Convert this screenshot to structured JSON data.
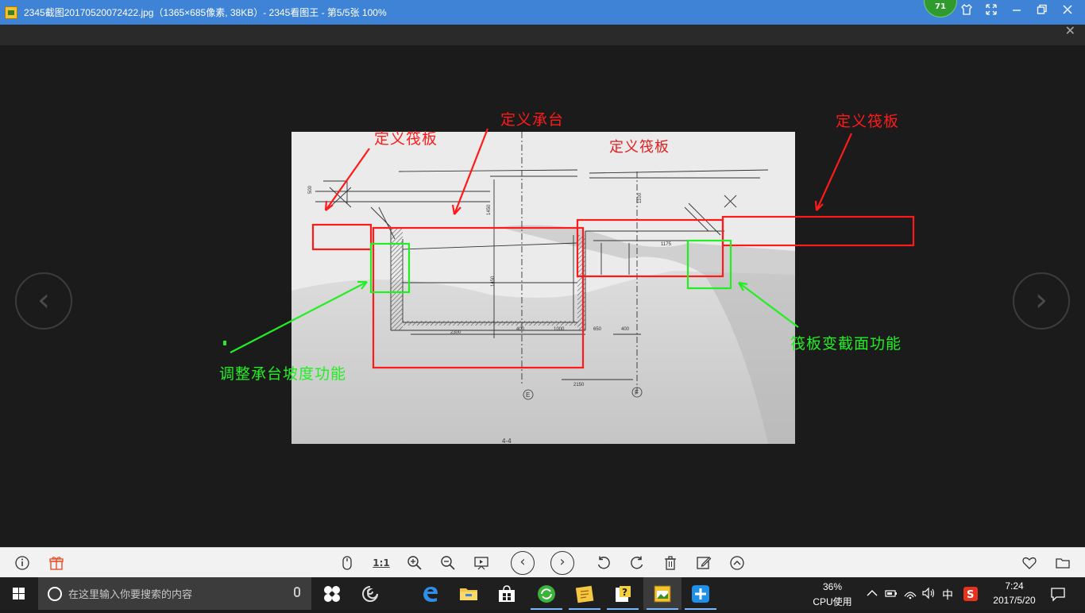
{
  "window": {
    "title": "2345截图20170520072422.jpg（1365×685像素, 38KB）- 2345看图王 - 第5/5张 100%",
    "badge_count": "71"
  },
  "photo": {
    "drawing_labels": [
      "定义筏板"
    ],
    "dims": [
      "2150",
      "2300",
      "1000",
      "400",
      "650",
      "1175",
      "400",
      "1100",
      "1450",
      "1450",
      "500"
    ],
    "axis_labels": [
      "E",
      "F"
    ],
    "section_label": "4-4"
  },
  "annotations": {
    "red": [
      "定义筏板",
      "定义承台",
      "定义筏板"
    ],
    "green": [
      "调整承台坡度功能",
      "筏板变截面功能"
    ]
  },
  "bottombar": {
    "actual_size_label": "1:1"
  },
  "taskbar": {
    "search_placeholder": "在这里输入你要搜索的内容",
    "cpu_percent": "36%",
    "cpu_label": "CPU使用",
    "ime": "中",
    "time": "7:24",
    "date": "2017/5/20"
  },
  "icons": {
    "app": "image-viewer-icon",
    "prev": "chevron-left-icon",
    "next": "chevron-right-icon"
  },
  "colors": {
    "titlebar": "#3f83d6",
    "annotation_red": "#ff1a1a",
    "annotation_green": "#22ee22"
  }
}
